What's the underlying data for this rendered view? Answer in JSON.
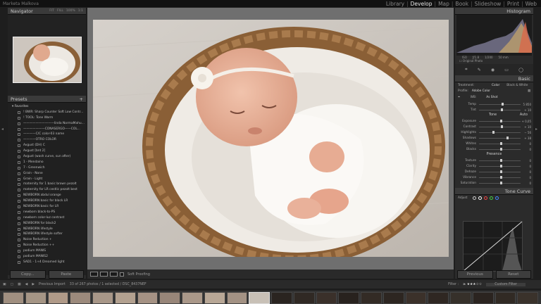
{
  "user_name": "Marketa Malkova",
  "modules": [
    "Library",
    "Develop",
    "Map",
    "Book",
    "Slideshow",
    "Print",
    "Web"
  ],
  "active_module": "Develop",
  "navigator": {
    "title": "Navigator",
    "options": [
      "FIT",
      "FILL",
      "100%",
      "1:1"
    ]
  },
  "presets": {
    "title": "Presets",
    "folder": "Favorites",
    "items": [
      "! BWR: Sharp Counter Soft Low Contr...",
      "! TOOL: Tone Warm",
      "——————————linda NormaMahu...",
      "———————CONASERGO——COL...",
      "————C/C color-03 name",
      "————OTRO COLOR",
      "Avgust (DH) C",
      "Avgust [bnt 2]",
      "Avgust (wash curve, sun after)",
      "1 - Mendaino",
      "7 - Greenwich",
      "Grain - None",
      "Grain - Light",
      "maternity for 1 basic brown pezolt",
      "maternity for LR cestlic pezolt best",
      "NEWBORN abdul orange",
      "NEWBORN basic for black LR",
      "NEWBORN basic for LR",
      "newborn black-to-PS",
      "newborn color-luz contrast",
      "NEWBORN for black2",
      "NEWBORN lifestyle",
      "NEWBORN lifestyle softer",
      "Noise Reduction +",
      "Noise Reduction ++",
      "podium MANIS",
      "podium MANIS2",
      "SAD1 - 1+4 Dreamed light"
    ]
  },
  "left_buttons": {
    "copy": "Copy...",
    "paste": "Paste"
  },
  "toolbar": {
    "soft_proofing": "Soft Proofing"
  },
  "histogram": {
    "title": "Histogram",
    "info": [
      "ISO",
      "ƒ/1.8",
      "1/200",
      "50 mm"
    ],
    "original_photo": "Original Photo"
  },
  "basic": {
    "title": "Basic",
    "treatment_label": "Treatment:",
    "treatment_color": "Color",
    "treatment_bw": "Black & White",
    "profile_label": "Profile:",
    "profile_value": "Adobe Color",
    "wb_label": "WB:",
    "wb_value": "As Shot",
    "temp": {
      "name": "Temp",
      "value": "5 850",
      "pos": 0.55
    },
    "tint": {
      "name": "Tint",
      "value": "+ 10",
      "pos": 0.52
    },
    "tone_label": "Tone",
    "auto": "Auto",
    "tone_rows": [
      {
        "name": "Exposure",
        "value": "+ 0,05",
        "pos": 0.51
      },
      {
        "name": "Contrast",
        "value": "+ 10",
        "pos": 0.53
      },
      {
        "name": "Highlights",
        "value": "− 56",
        "pos": 0.32
      },
      {
        "name": "Shadows",
        "value": "+ 38",
        "pos": 0.66
      },
      {
        "name": "Whites",
        "value": "0",
        "pos": 0.5
      },
      {
        "name": "Blacks",
        "value": "0",
        "pos": 0.5
      }
    ],
    "presence_label": "Presence",
    "presence_rows": [
      {
        "name": "Texture",
        "value": "0",
        "pos": 0.5
      },
      {
        "name": "Clarity",
        "value": "0",
        "pos": 0.5
      },
      {
        "name": "Dehaze",
        "value": "0",
        "pos": 0.5
      },
      {
        "name": "Vibrance",
        "value": "0",
        "pos": 0.5
      },
      {
        "name": "Saturation",
        "value": "0",
        "pos": 0.5
      }
    ]
  },
  "tone_curve": {
    "title": "Tone Curve",
    "adjust_label": "Adjust"
  },
  "right_buttons": {
    "previous": "Previous",
    "reset": "Reset"
  },
  "filmstrip": {
    "source": "Previous Import",
    "count": "33 of 267 photos / 1 selected / DSC_8437NEF",
    "filter_label": "Filter :",
    "filter_value": "Custom Filter"
  }
}
